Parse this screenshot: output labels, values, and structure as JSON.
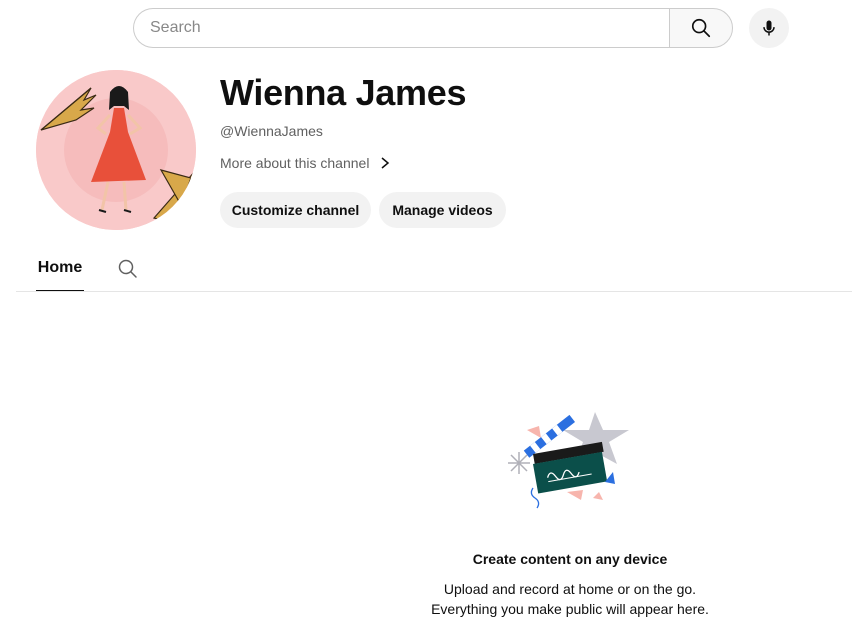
{
  "search": {
    "placeholder": "Search"
  },
  "icons": {
    "search": "search-icon",
    "mic": "microphone-icon",
    "chevron": "chevron-right-icon",
    "tab_search": "search-icon"
  },
  "channel": {
    "name": "Wienna James",
    "handle": "@WiennaJames",
    "more_about": "More about this channel",
    "avatar_bg": "#f9c9c9"
  },
  "buttons": {
    "customize": "Customize channel",
    "manage": "Manage videos"
  },
  "tabs": [
    {
      "label": "Home",
      "active": true
    }
  ],
  "empty_state": {
    "title": "Create content on any device",
    "line1": "Upload and record at home or on the go.",
    "line2": "Everything you make public will appear here."
  },
  "colors": {
    "text": "#0f0f0f",
    "secondary": "#606060",
    "pill_bg": "#f2f2f2",
    "accent_blue": "#3ea6ff",
    "teal": "#0b4f4a"
  }
}
